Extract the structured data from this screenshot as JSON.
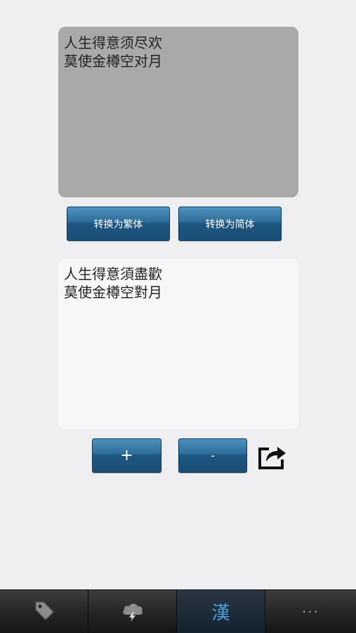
{
  "input": {
    "text": "人生得意须尽欢\n莫使金樽空对月"
  },
  "buttons": {
    "to_traditional": "转换为繁体",
    "to_simplified": "转换为简体",
    "plus": "+",
    "minus": "-"
  },
  "output": {
    "text": "人生得意須盡歡\n莫使金樽空對月"
  },
  "tabs": [
    {
      "icon": "tag-icon"
    },
    {
      "icon": "cloud-lightning-icon"
    },
    {
      "icon": "han-character-icon",
      "label": "漢",
      "active": true
    },
    {
      "icon": "more-icon",
      "label": "···"
    }
  ]
}
